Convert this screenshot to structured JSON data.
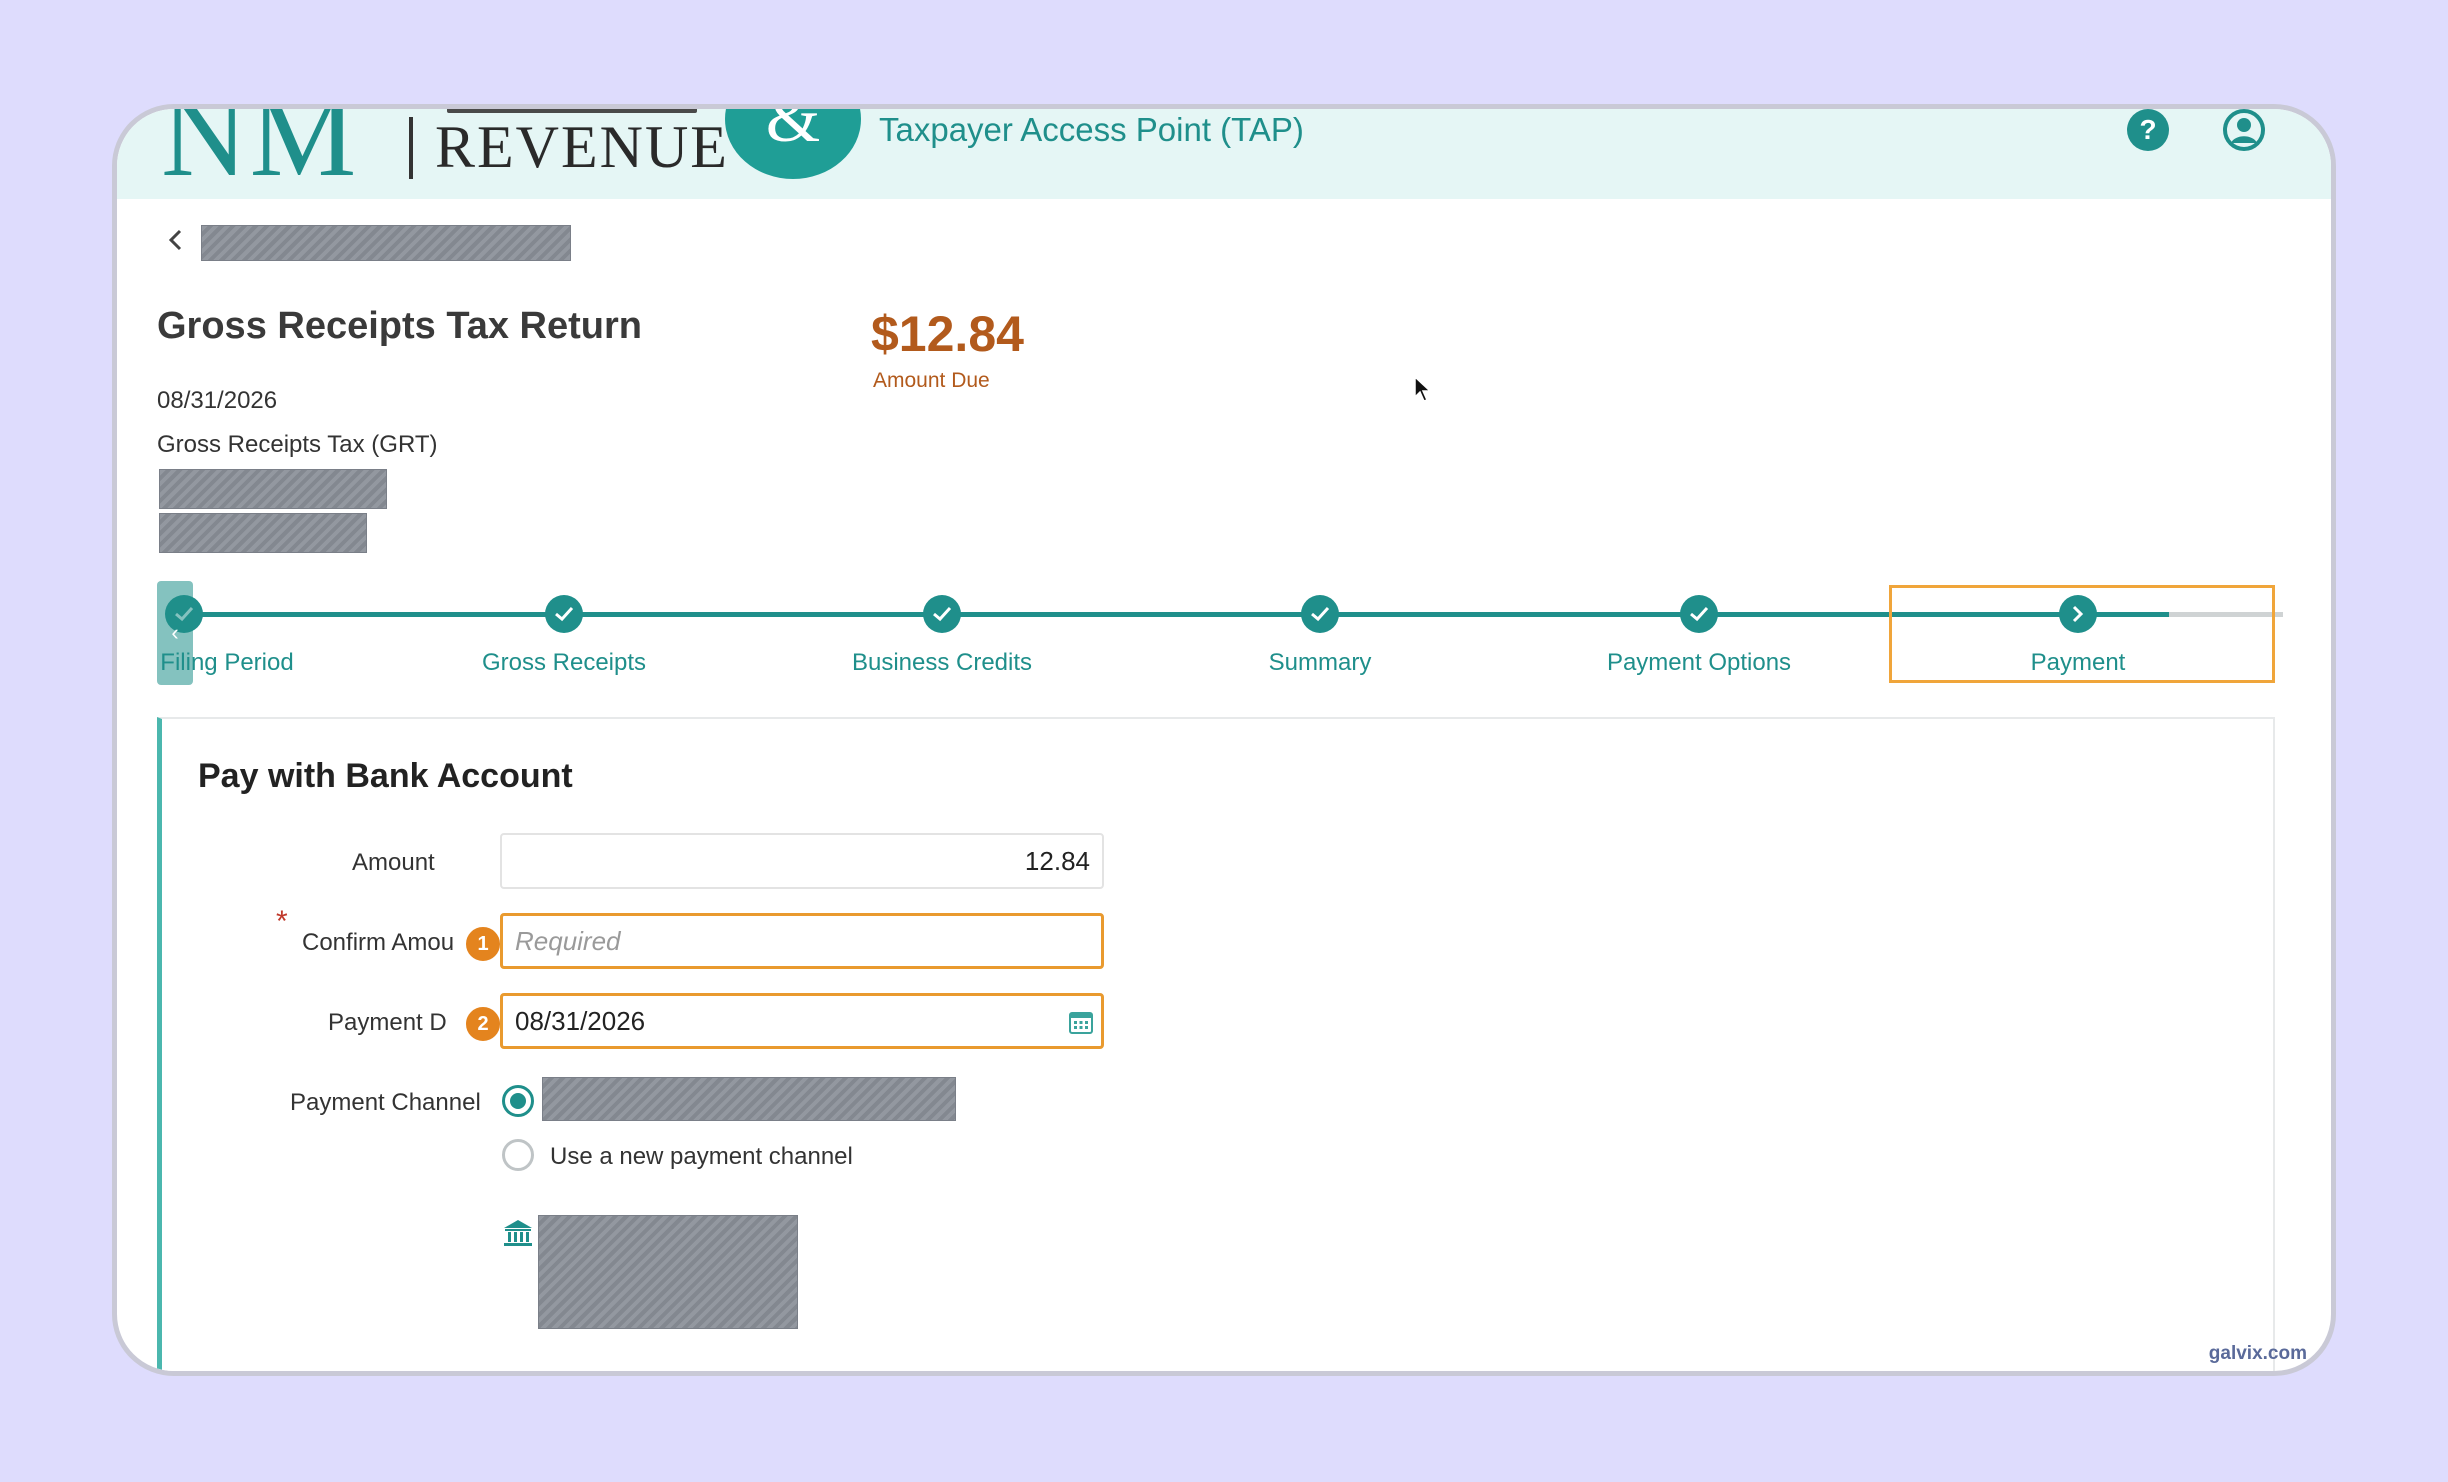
{
  "header": {
    "logo_primary": "NM",
    "logo_secondary": "REVENUE",
    "logo_symbol": "&",
    "title": "Taxpayer Access Point (TAP)",
    "help_icon": "help-icon",
    "user_icon": "user-icon"
  },
  "page": {
    "title": "Gross Receipts Tax Return",
    "period_date": "08/31/2026",
    "tax_type": "Gross Receipts Tax (GRT)",
    "amount_due_value": "$12.84",
    "amount_due_label": "Amount Due"
  },
  "stepper": {
    "steps": [
      {
        "label": "Filing Period",
        "state": "complete"
      },
      {
        "label": "Gross Receipts",
        "state": "complete"
      },
      {
        "label": "Business Credits",
        "state": "complete"
      },
      {
        "label": "Summary",
        "state": "complete"
      },
      {
        "label": "Payment Options",
        "state": "complete"
      },
      {
        "label": "Payment",
        "state": "current"
      }
    ]
  },
  "form": {
    "title": "Pay with Bank Account",
    "amount_label": "Amount",
    "amount_value": "12.84",
    "confirm_label": "Confirm Amou",
    "confirm_placeholder": "Required",
    "payment_date_label": "Payment D",
    "payment_date_value": "08/31/2026",
    "payment_channel_label": "Payment Channel",
    "new_channel_label": "Use a new payment channel",
    "badge_1": "1",
    "badge_2": "2",
    "required_marker": "*"
  },
  "colors": {
    "brand_teal": "#1f8f8b",
    "accent_orange": "#e99a2f",
    "amount_due": "#b25a1c"
  },
  "watermark": "galvix.com"
}
